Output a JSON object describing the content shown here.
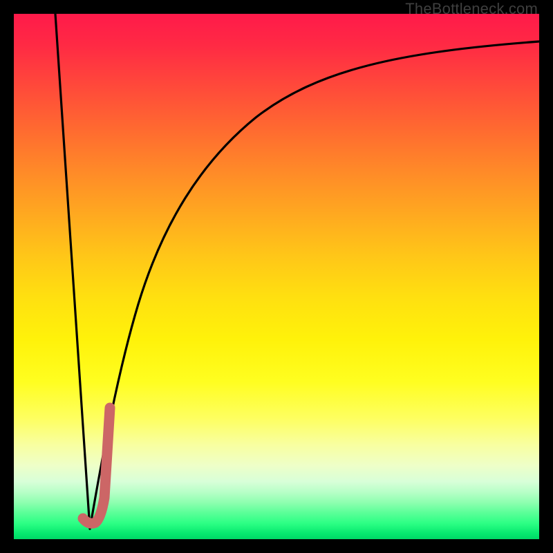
{
  "watermark": "TheBottleneck.com",
  "colors": {
    "frame": "#000000",
    "curve": "#000000",
    "highlight": "#cc6666",
    "gradient_top": "#ff1a4a",
    "gradient_mid": "#fff20a",
    "gradient_bottom": "#00d867"
  },
  "chart_data": {
    "type": "line",
    "title": "",
    "xlabel": "",
    "ylabel": "",
    "xlim": [
      0,
      100
    ],
    "ylim": [
      0,
      100
    ],
    "grid": false,
    "legend": false,
    "series": [
      {
        "name": "left-slope",
        "x": [
          7.9,
          14.5
        ],
        "y": [
          100,
          2
        ]
      },
      {
        "name": "right-curve",
        "x": [
          14.5,
          16,
          18,
          20,
          23,
          27,
          32,
          38,
          45,
          53,
          62,
          72,
          83,
          92,
          100
        ],
        "y": [
          2,
          12,
          24,
          34,
          45,
          55,
          64,
          71,
          77,
          82,
          85.5,
          88,
          90,
          91.2,
          92
        ]
      },
      {
        "name": "highlight-segment",
        "x": [
          13.2,
          14.2,
          15.0,
          15.8,
          16.6,
          17.4,
          18.0
        ],
        "y": [
          4.0,
          3.0,
          3.2,
          8.0,
          14.0,
          20.0,
          25.0
        ]
      }
    ],
    "annotations": []
  }
}
